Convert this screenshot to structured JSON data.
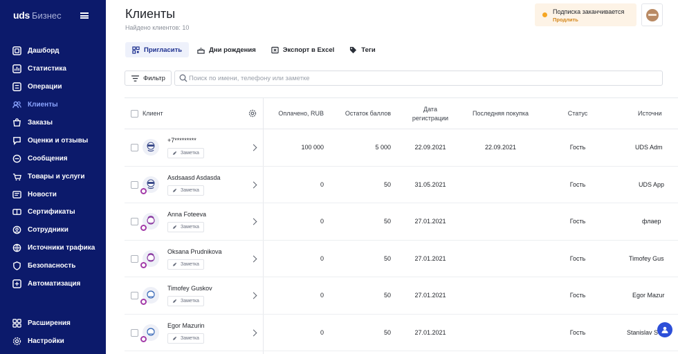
{
  "brand": {
    "logo": "uds",
    "product": "Бизнес"
  },
  "sidebar": {
    "items": [
      {
        "label": "Дашборд",
        "icon": "dashboard-icon"
      },
      {
        "label": "Статистика",
        "icon": "chart-icon"
      },
      {
        "label": "Операции",
        "icon": "operations-icon"
      },
      {
        "label": "Клиенты",
        "icon": "users-icon",
        "active": true
      },
      {
        "label": "Заказы",
        "icon": "orders-icon"
      },
      {
        "label": "Оценки и отзывы",
        "icon": "reviews-icon"
      },
      {
        "label": "Сообщения",
        "icon": "messages-icon"
      },
      {
        "label": "Товары и услуги",
        "icon": "goods-icon"
      },
      {
        "label": "Новости",
        "icon": "news-icon"
      },
      {
        "label": "Сертификаты",
        "icon": "certificates-icon"
      },
      {
        "label": "Сотрудники",
        "icon": "employees-icon"
      },
      {
        "label": "Источники трафика",
        "icon": "traffic-icon"
      },
      {
        "label": "Безопасность",
        "icon": "security-icon"
      },
      {
        "label": "Автоматизация",
        "icon": "automation-icon"
      }
    ],
    "bottom": [
      {
        "label": "Расширения",
        "icon": "extensions-icon"
      },
      {
        "label": "Настройки",
        "icon": "settings-icon"
      }
    ]
  },
  "header": {
    "title": "Клиенты",
    "subtitle": "Найдено клиентов: 10",
    "notice": {
      "title": "Подписка заканчивается",
      "link": "Продлить",
      "color": "#f5a623"
    }
  },
  "actions": {
    "invite": "Пригласить",
    "birthdays": "Дни рождения",
    "export": "Экспорт в Excel",
    "tags": "Теги"
  },
  "filter": {
    "label": "Фильтр"
  },
  "search": {
    "placeholder": "Поиск по имени, телефону или заметке",
    "value": ""
  },
  "table": {
    "columns": {
      "client": "Клиент",
      "paid": "Оплачено, RUB",
      "balance": "Остаток баллов",
      "reg_date_1": "Дата",
      "reg_date_2": "регистрации",
      "last_purchase": "Последняя покупка",
      "status": "Статус",
      "source": "Источни"
    },
    "note_label": "Заметка",
    "rows": [
      {
        "name": "+7*********",
        "paid": "100 000",
        "balance": "5 000",
        "reg": "22.09.2021",
        "last": "22.09.2021",
        "status": "Гость",
        "source": "UDS Adm"
      },
      {
        "name": "Asdsaasd Asdasda",
        "paid": "0",
        "balance": "50",
        "reg": "31.05.2021",
        "last": "",
        "status": "Гость",
        "source": "UDS App"
      },
      {
        "name": "Anna Foteeva",
        "paid": "0",
        "balance": "50",
        "reg": "27.01.2021",
        "last": "",
        "status": "Гость",
        "source": "флаер"
      },
      {
        "name": "Oksana Prudnikova",
        "paid": "0",
        "balance": "50",
        "reg": "27.01.2021",
        "last": "",
        "status": "Гость",
        "source": "Timofey Gus"
      },
      {
        "name": "Timofey Guskov",
        "paid": "0",
        "balance": "50",
        "reg": "27.01.2021",
        "last": "",
        "status": "Гость",
        "source": "Egor Mazur"
      },
      {
        "name": "Egor Mazurin",
        "paid": "0",
        "balance": "50",
        "reg": "27.01.2021",
        "last": "",
        "status": "Гость",
        "source": "Stanislav S"
      }
    ]
  },
  "colors": {
    "sidebar": "#0c1a6b",
    "accent": "#2d4fd8",
    "badge": "#a23aa8"
  }
}
